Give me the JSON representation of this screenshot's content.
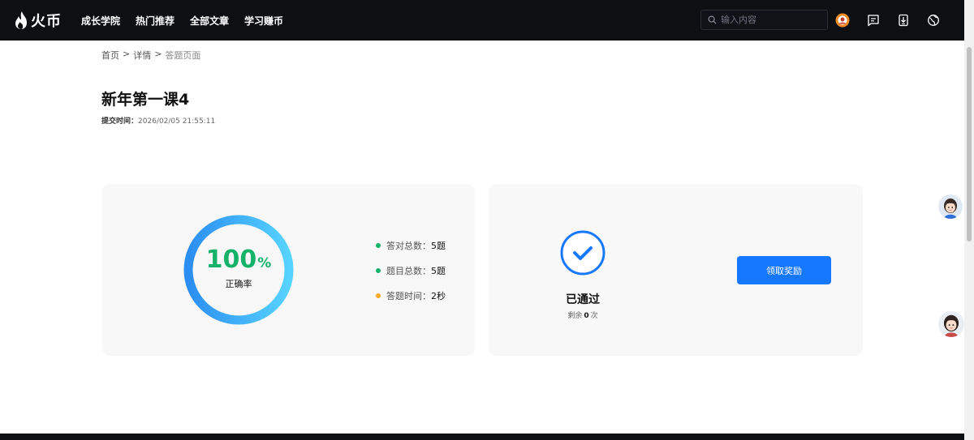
{
  "header": {
    "logo_text": "火币",
    "nav": [
      "成长学院",
      "热门推荐",
      "全部文章",
      "学习赚币"
    ],
    "search_placeholder": "输入内容",
    "icons": [
      "search-icon",
      "user-avatar-icon",
      "message-icon",
      "download-icon",
      "globe-icon"
    ]
  },
  "breadcrumb": [
    "首页",
    ">",
    "详情",
    ">",
    "答题页面"
  ],
  "page": {
    "title": "新年第一课4",
    "submit_label": "提交时间：",
    "submit_time": "2026/02/05 21:55:11"
  },
  "result": {
    "accuracy_value": "100",
    "accuracy_unit": "%",
    "accuracy_label": "正确率",
    "accuracy_fraction": 1.0,
    "stats": [
      {
        "label": "答对总数：",
        "value": "5题",
        "color": "#17b26a"
      },
      {
        "label": "题目总数：",
        "value": "5题",
        "color": "#17b26a"
      },
      {
        "label": "答题时间：",
        "value": "2秒",
        "color": "#f5a623"
      }
    ]
  },
  "status": {
    "pass_text": "已通过",
    "remain_prefix": "剩余",
    "remain_count": "0",
    "remain_suffix": "次",
    "button_label": "领取奖励"
  },
  "colors": {
    "accent": "#1677ff",
    "success": "#17b26a",
    "warning": "#f5a623",
    "header_bg": "#0e0f13"
  }
}
